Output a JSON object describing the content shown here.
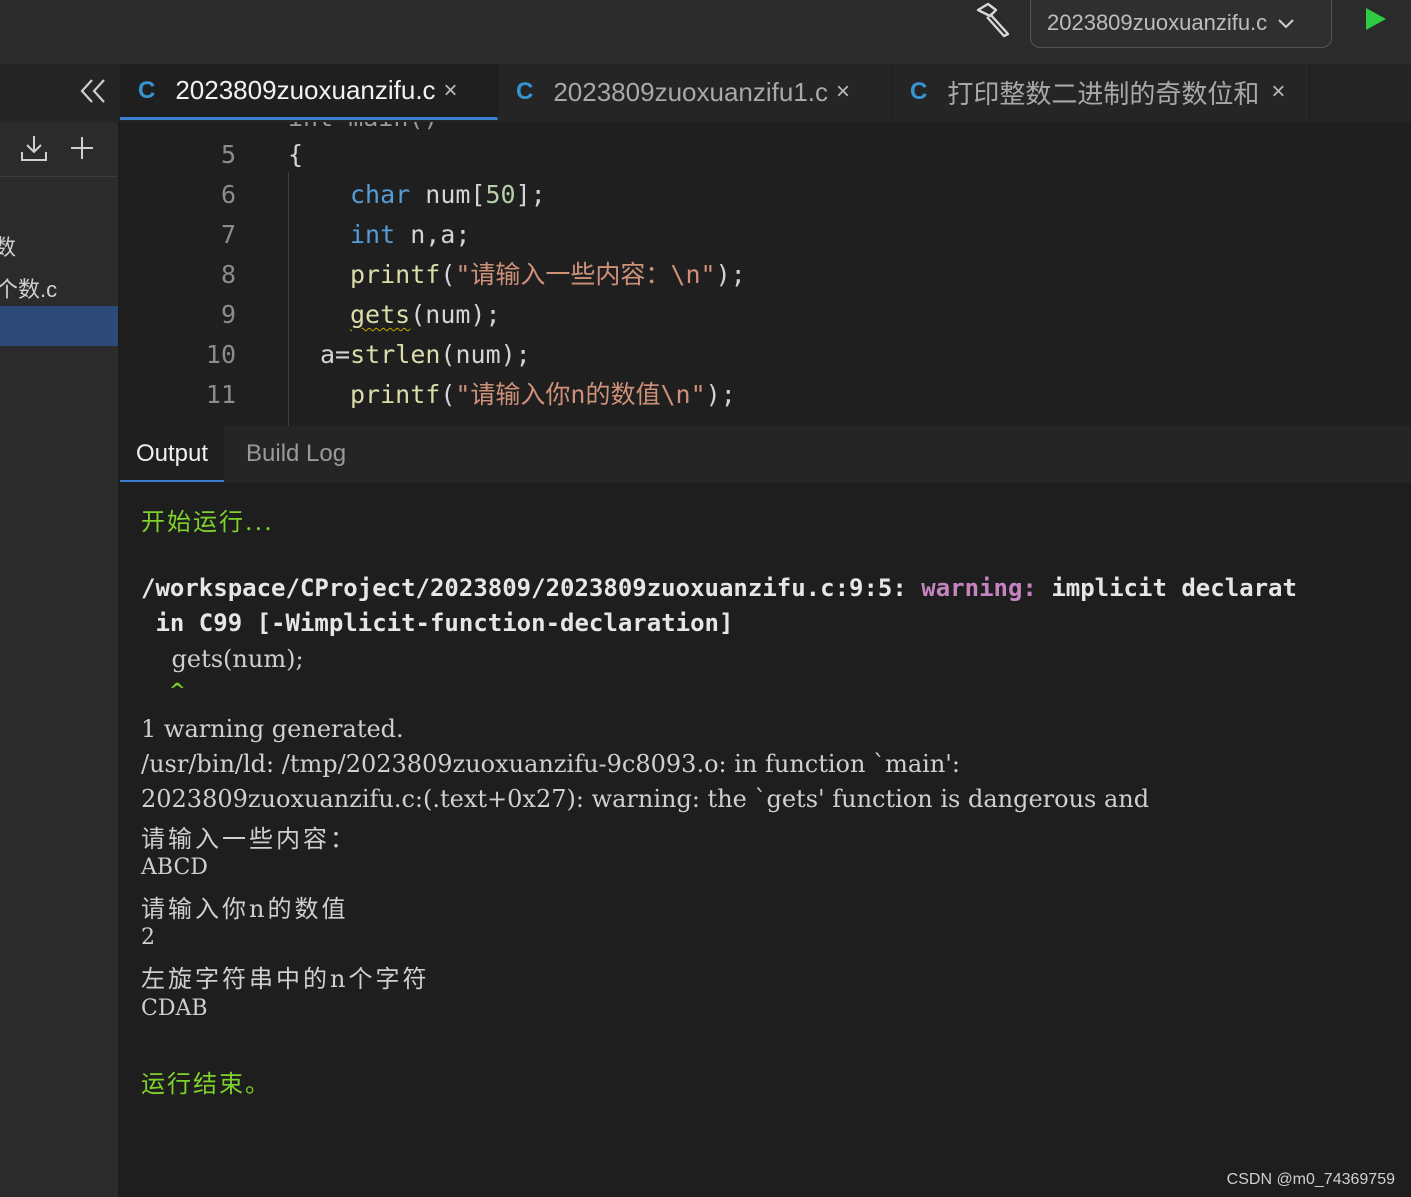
{
  "toolbar": {
    "build_icon": "hammer-icon",
    "file_selector": "2023809zuoxuanzifu.c",
    "run_icon": "play-icon",
    "colors": {
      "run": "#2ecc40",
      "accent": "#3a7fd0"
    }
  },
  "tabs": [
    {
      "icon": "C",
      "label": "2023809zuoxuanzifu.c",
      "active": true
    },
    {
      "icon": "C",
      "label": "2023809zuoxuanzifu1.c",
      "active": false
    },
    {
      "icon": "C",
      "label": "打印整数二进制的奇数位和",
      "active": false
    }
  ],
  "sidebar": {
    "items": [
      "数",
      "个数.c"
    ]
  },
  "editor": {
    "partial_top": "int main()",
    "lines": [
      {
        "no": "5"
      },
      {
        "no": "6"
      },
      {
        "no": "7"
      },
      {
        "no": "8"
      },
      {
        "no": "9"
      },
      {
        "no": "10"
      },
      {
        "no": "11"
      }
    ],
    "tokens": {
      "brace": "{",
      "char_kw": "char",
      "num_decl": " num[",
      "fifty": "50",
      "decl_end": "];",
      "int_kw": "int",
      "na": " n,a;",
      "printf": "printf",
      "str1": "\"请输入一些内容：\\n\"",
      "close_paren": ");",
      "gets": "gets",
      "gets_args": "(num);",
      "a_eq": "a=",
      "strlen": "strlen",
      "strlen_args": "(num);",
      "str2": "\"请输入你n的数值\\n\"",
      "open_paren": "("
    }
  },
  "output_tabs": [
    "Output",
    "Build Log"
  ],
  "output": {
    "start": "开始运行...",
    "path": "/workspace/CProject/2023809/2023809zuoxuanzifu.c:9:5:",
    "warning_word": "warning:",
    "warning_msg": "implicit declarat",
    "warning_cont": " in C99 [-Wimplicit-function-declaration]",
    "code_echo": "    gets(num);",
    "caret": "    ^",
    "generated": "1 warning generated.",
    "ld": "/usr/bin/ld: /tmp/2023809zuoxuanzifu-9c8093.o: in function `main':",
    "ld2": "2023809zuoxuanzifu.c:(.text+0x27): warning: the `gets' function is dangerous and",
    "prompt1": "请输入一些内容：",
    "input1": "ABCD",
    "prompt2": "请输入你n的数值",
    "input2": "2",
    "prompt3": "左旋字符串中的n个字符",
    "result": "CDAB",
    "end": "运行结束。"
  },
  "watermark": "CSDN @m0_74369759"
}
